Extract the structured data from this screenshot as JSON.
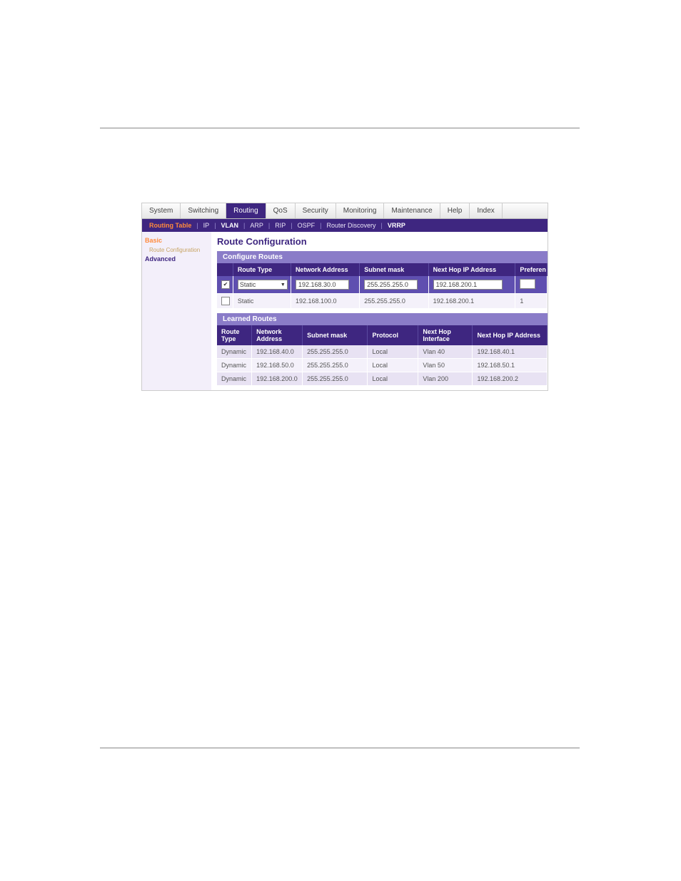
{
  "topTabs": [
    "System",
    "Switching",
    "Routing",
    "QoS",
    "Security",
    "Monitoring",
    "Maintenance",
    "Help",
    "Index"
  ],
  "activeTopTab": "Routing",
  "subTabs": [
    "Routing Table",
    "IP",
    "VLAN",
    "ARP",
    "RIP",
    "OSPF",
    "Router Discovery",
    "VRRP"
  ],
  "activeSubTab": "Routing Table",
  "boldSubTabs": [
    "VLAN",
    "VRRP"
  ],
  "sidebar": {
    "basic": "Basic",
    "routeCfg": "Route\n  Configuration",
    "advanced": "Advanced"
  },
  "page": {
    "title": "Route Configuration"
  },
  "configure": {
    "header": "Configure Routes",
    "cols": [
      "Route Type",
      "Network Address",
      "Subnet mask",
      "Next Hop IP Address",
      "Preferen"
    ],
    "edit": {
      "routeType": "Static",
      "network": "192.168.30.0",
      "mask": "255.255.255.0",
      "nextHop": "192.168.200.1"
    },
    "rows": [
      {
        "routeType": "Static",
        "network": "192.168.100.0",
        "mask": "255.255.255.0",
        "nextHop": "192.168.200.1",
        "pref": "1"
      }
    ]
  },
  "learned": {
    "header": "Learned Routes",
    "cols": [
      "Route Type",
      "Network Address",
      "Subnet mask",
      "Protocol",
      "Next Hop Interface",
      "Next Hop IP Address"
    ],
    "rows": [
      {
        "type": "Dynamic",
        "net": "192.168.40.0",
        "mask": "255.255.255.0",
        "proto": "Local",
        "iface": "Vlan 40",
        "nh": "192.168.40.1"
      },
      {
        "type": "Dynamic",
        "net": "192.168.50.0",
        "mask": "255.255.255.0",
        "proto": "Local",
        "iface": "Vlan 50",
        "nh": "192.168.50.1"
      },
      {
        "type": "Dynamic",
        "net": "192.168.200.0",
        "mask": "255.255.255.0",
        "proto": "Local",
        "iface": "Vlan 200",
        "nh": "192.168.200.2"
      }
    ]
  }
}
